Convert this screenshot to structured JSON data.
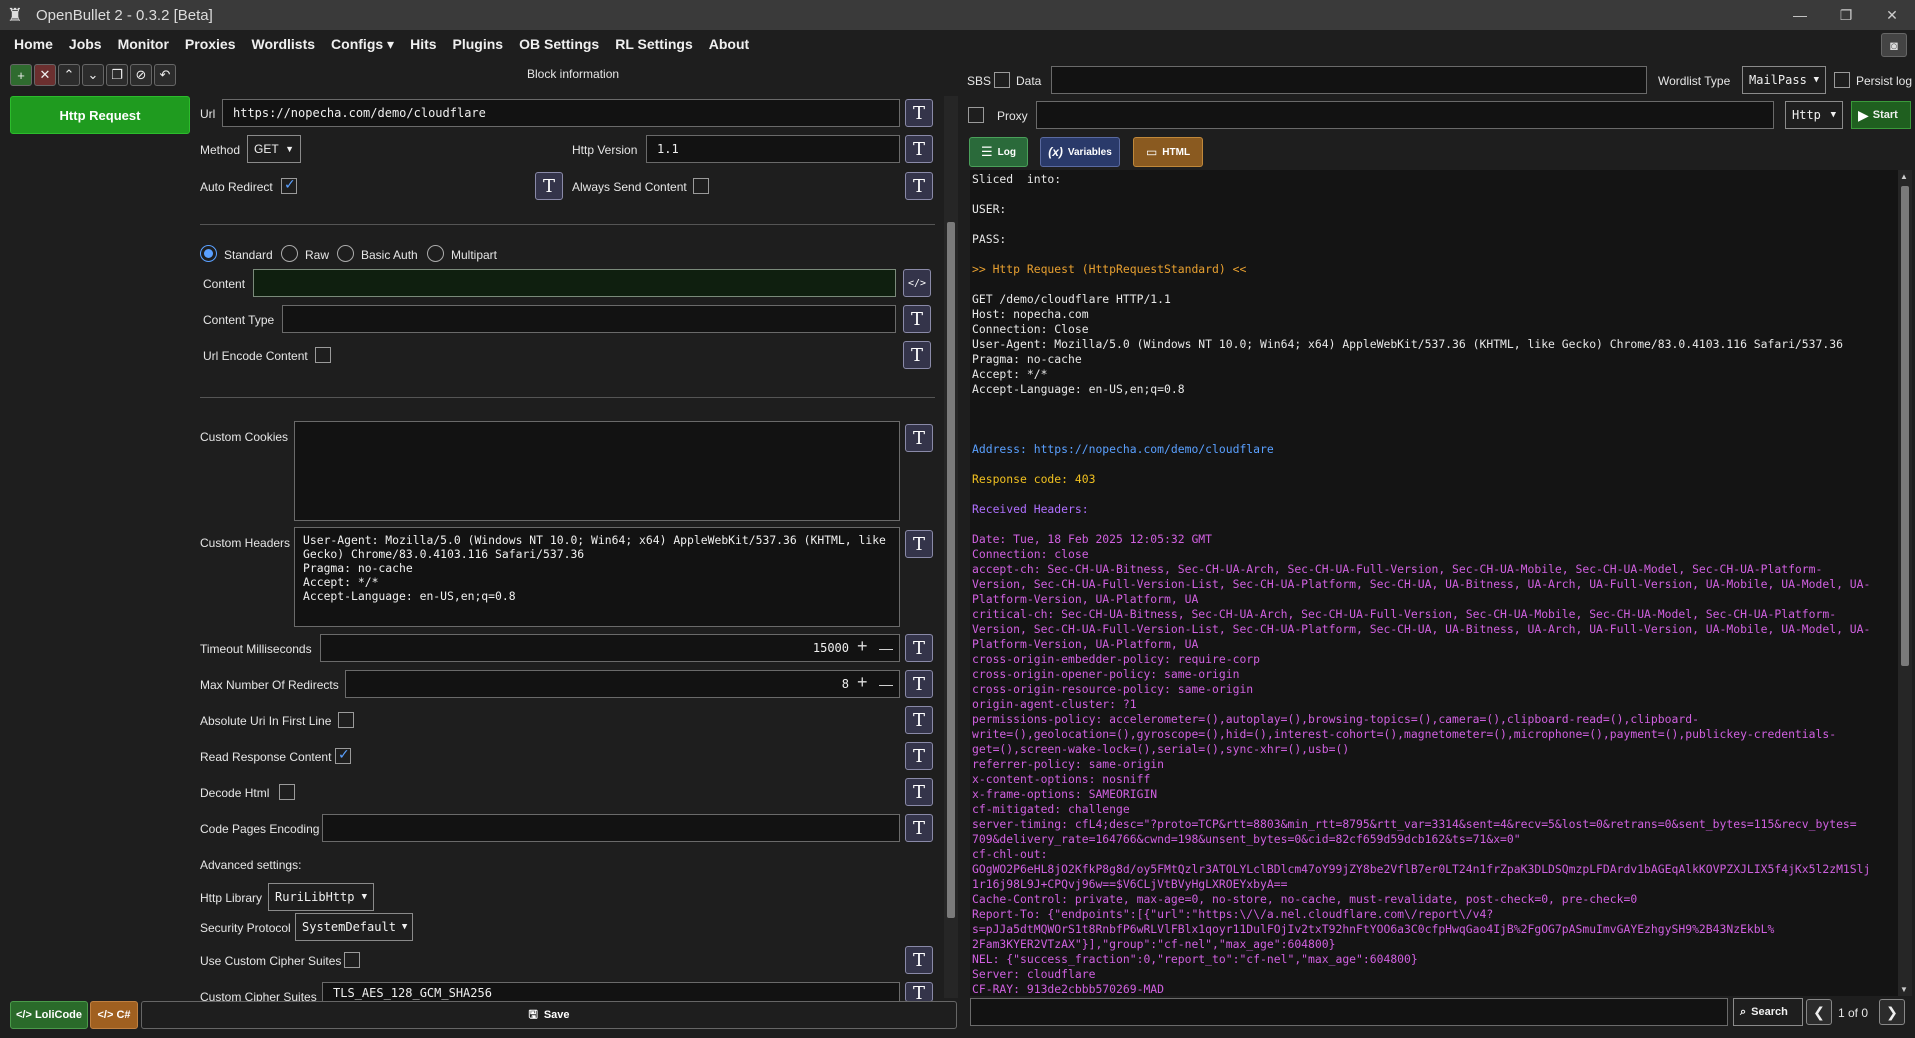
{
  "window": {
    "title": "OpenBullet 2 - 0.3.2 [Beta]",
    "minimize": "—",
    "restore": "❐",
    "close": "✕"
  },
  "menu": {
    "items": [
      "Home",
      "Jobs",
      "Monitor",
      "Proxies",
      "Wordlists",
      "Configs ▾",
      "Hits",
      "Plugins",
      "OB Settings",
      "RL Settings",
      "About"
    ]
  },
  "toolbar": {
    "buttons": [
      "+",
      "✕",
      "⌃",
      "⌄",
      "❐",
      "⊘",
      "↶"
    ]
  },
  "blocks": {
    "selected_label": "Http Request"
  },
  "block_info": {
    "header": "Block information",
    "url_label": "Url",
    "url_value": "https://nopecha.com/demo/cloudflare",
    "method_label": "Method",
    "method_value": "GET",
    "http_version_label": "Http Version",
    "http_version_value": "1.1",
    "auto_redirect_label": "Auto Redirect",
    "always_send_content_label": "Always Send Content",
    "content_modes": [
      "Standard",
      "Raw",
      "Basic Auth",
      "Multipart"
    ],
    "content_label": "Content",
    "content_value": "",
    "content_type_label": "Content Type",
    "content_type_value": "",
    "url_encode_label": "Url Encode Content",
    "custom_cookies_label": "Custom Cookies",
    "custom_cookies_value": "",
    "custom_headers_label": "Custom Headers",
    "custom_headers_value": "User-Agent: Mozilla/5.0 (Windows NT 10.0; Win64; x64) AppleWebKit/537.36 (KHTML, like\nGecko) Chrome/83.0.4103.116 Safari/537.36\nPragma: no-cache\nAccept: */*\nAccept-Language: en-US,en;q=0.8",
    "timeout_label": "Timeout Milliseconds",
    "timeout_value": "15000",
    "max_redirects_label": "Max Number Of Redirects",
    "max_redirects_value": "8",
    "absolute_uri_label": "Absolute Uri In First Line",
    "read_response_label": "Read Response Content",
    "decode_html_label": "Decode Html",
    "code_pages_label": "Code Pages Encoding",
    "code_pages_value": "",
    "advanced_label": "Advanced settings:",
    "http_library_label": "Http Library",
    "http_library_value": "RuriLibHttp",
    "security_protocol_label": "Security Protocol",
    "security_protocol_value": "SystemDefault",
    "use_cipher_label": "Use Custom Cipher Suites",
    "cipher_suites_label": "Custom Cipher Suites",
    "cipher_suites_value": "TLS_AES_128_GCM_SHA256",
    "t_glyph": "T",
    "code_glyph": "</>",
    "plus": "+",
    "minus": "—"
  },
  "bottom_left": {
    "lolicode_label": "</> LoliCode",
    "csharp_label": "</> C#",
    "save_label": "Save"
  },
  "debugger": {
    "sbs_label": "SBS",
    "data_label": "Data",
    "data_value": "",
    "wordlist_type_label": "Wordlist Type",
    "wordlist_type_value": "MailPass",
    "persist_log_label": "Persist log",
    "proxy_label": "Proxy",
    "proxy_value": "",
    "proxy_type_value": "Http",
    "start_label": "Start",
    "log_tab": "Log",
    "variables_tab": "Variables",
    "html_tab": "HTML",
    "search_value": "",
    "search_label": "Search",
    "page_counter": "1 of 0"
  },
  "log_lines": [
    {
      "c": "c-white",
      "t": "Sliced  into:"
    },
    {
      "c": "c-white",
      "t": " "
    },
    {
      "c": "c-white",
      "t": "USER:"
    },
    {
      "c": "c-white",
      "t": " "
    },
    {
      "c": "c-white",
      "t": "PASS:"
    },
    {
      "c": "c-white",
      "t": " "
    },
    {
      "c": "c-orange",
      "t": ">> Http Request (HttpRequestStandard) <<"
    },
    {
      "c": "c-white",
      "t": " "
    },
    {
      "c": "c-white",
      "t": "GET /demo/cloudflare HTTP/1.1"
    },
    {
      "c": "c-white",
      "t": "Host: nopecha.com"
    },
    {
      "c": "c-white",
      "t": "Connection: Close"
    },
    {
      "c": "c-white",
      "t": "User-Agent: Mozilla/5.0 (Windows NT 10.0; Win64; x64) AppleWebKit/537.36 (KHTML, like Gecko) Chrome/83.0.4103.116 Safari/537.36"
    },
    {
      "c": "c-white",
      "t": "Pragma: no-cache"
    },
    {
      "c": "c-white",
      "t": "Accept: */*"
    },
    {
      "c": "c-white",
      "t": "Accept-Language: en-US,en;q=0.8"
    },
    {
      "c": "c-white",
      "t": " "
    },
    {
      "c": "c-white",
      "t": " "
    },
    {
      "c": "c-white",
      "t": " "
    },
    {
      "c": "c-blue",
      "t": "Address: https://nopecha.com/demo/cloudflare"
    },
    {
      "c": "c-white",
      "t": " "
    },
    {
      "c": "c-yellow",
      "t": "Response code: 403"
    },
    {
      "c": "c-white",
      "t": " "
    },
    {
      "c": "c-purple",
      "t": "Received Headers:"
    },
    {
      "c": "c-white",
      "t": " "
    },
    {
      "c": "c-violet",
      "t": "Date: Tue, 18 Feb 2025 12:05:32 GMT"
    },
    {
      "c": "c-violet",
      "t": "Connection: close"
    },
    {
      "c": "c-violet",
      "t": "accept-ch: Sec-CH-UA-Bitness, Sec-CH-UA-Arch, Sec-CH-UA-Full-Version, Sec-CH-UA-Mobile, Sec-CH-UA-Model, Sec-CH-UA-Platform-\nVersion, Sec-CH-UA-Full-Version-List, Sec-CH-UA-Platform, Sec-CH-UA, UA-Bitness, UA-Arch, UA-Full-Version, UA-Mobile, UA-Model, UA-\nPlatform-Version, UA-Platform, UA"
    },
    {
      "c": "c-violet",
      "t": "critical-ch: Sec-CH-UA-Bitness, Sec-CH-UA-Arch, Sec-CH-UA-Full-Version, Sec-CH-UA-Mobile, Sec-CH-UA-Model, Sec-CH-UA-Platform-\nVersion, Sec-CH-UA-Full-Version-List, Sec-CH-UA-Platform, Sec-CH-UA, UA-Bitness, UA-Arch, UA-Full-Version, UA-Mobile, UA-Model, UA-\nPlatform-Version, UA-Platform, UA"
    },
    {
      "c": "c-violet",
      "t": "cross-origin-embedder-policy: require-corp"
    },
    {
      "c": "c-violet",
      "t": "cross-origin-opener-policy: same-origin"
    },
    {
      "c": "c-violet",
      "t": "cross-origin-resource-policy: same-origin"
    },
    {
      "c": "c-violet",
      "t": "origin-agent-cluster: ?1"
    },
    {
      "c": "c-violet",
      "t": "permissions-policy: accelerometer=(),autoplay=(),browsing-topics=(),camera=(),clipboard-read=(),clipboard-\nwrite=(),geolocation=(),gyroscope=(),hid=(),interest-cohort=(),magnetometer=(),microphone=(),payment=(),publickey-credentials-\nget=(),screen-wake-lock=(),serial=(),sync-xhr=(),usb=()"
    },
    {
      "c": "c-violet",
      "t": "referrer-policy: same-origin"
    },
    {
      "c": "c-violet",
      "t": "x-content-options: nosniff"
    },
    {
      "c": "c-violet",
      "t": "x-frame-options: SAMEORIGIN"
    },
    {
      "c": "c-violet",
      "t": "cf-mitigated: challenge"
    },
    {
      "c": "c-violet",
      "t": "server-timing: cfL4;desc=\"?proto=TCP&rtt=8803&min_rtt=8795&rtt_var=3314&sent=4&recv=5&lost=0&retrans=0&sent_bytes=115&recv_bytes=\n709&delivery_rate=164766&cwnd=198&unsent_bytes=0&cid=82cf659d59dcb162&ts=71&x=0\""
    },
    {
      "c": "c-violet",
      "t": "cf-chl-out:\nGOgWO2P6eHL8jO2KfkP8g8d/oy5FMtQzlr3ATOLYLclBDlcm47oY99jZY8be2VflB7er0LT24n1frZpaK3DLDSQmzpLFDArdv1bAGEqAlkKOVPZXJLIX5f4jKx5l2zM1Slj\n1r16j98L9J+CPQvj96w==$V6CLjVtBVyHgLXROEYxbyA=="
    },
    {
      "c": "c-violet",
      "t": "Cache-Control: private, max-age=0, no-store, no-cache, must-revalidate, post-check=0, pre-check=0"
    },
    {
      "c": "c-violet",
      "t": "Report-To: {\"endpoints\":[{\"url\":\"https:\\/\\/a.nel.cloudflare.com\\/report\\/v4?\ns=pJJa5dtMQWOrS1t8RnbfP6wRLVlFBlx1qoyr11DulFOjIv2txT92hnFtYOO6a3C0cfpHwqGao4IjB%2FgOG7pASmuImvGAYEzhgySH9%2B43NzEkbL%\n2Fam3KYER2VTzAX\"}],\"group\":\"cf-nel\",\"max_age\":604800}"
    },
    {
      "c": "c-violet",
      "t": "NEL: {\"success_fraction\":0,\"report_to\":\"cf-nel\",\"max_age\":604800}"
    },
    {
      "c": "c-violet",
      "t": "Server: cloudflare"
    },
    {
      "c": "c-violet",
      "t": "CF-RAY: 913de2cbbb570269-MAD"
    }
  ],
  "colors": {
    "accent_green": "#1f9b1f",
    "log_orange": "#e8a030",
    "log_blue": "#5aa0ff",
    "log_violet": "#d060e0"
  }
}
